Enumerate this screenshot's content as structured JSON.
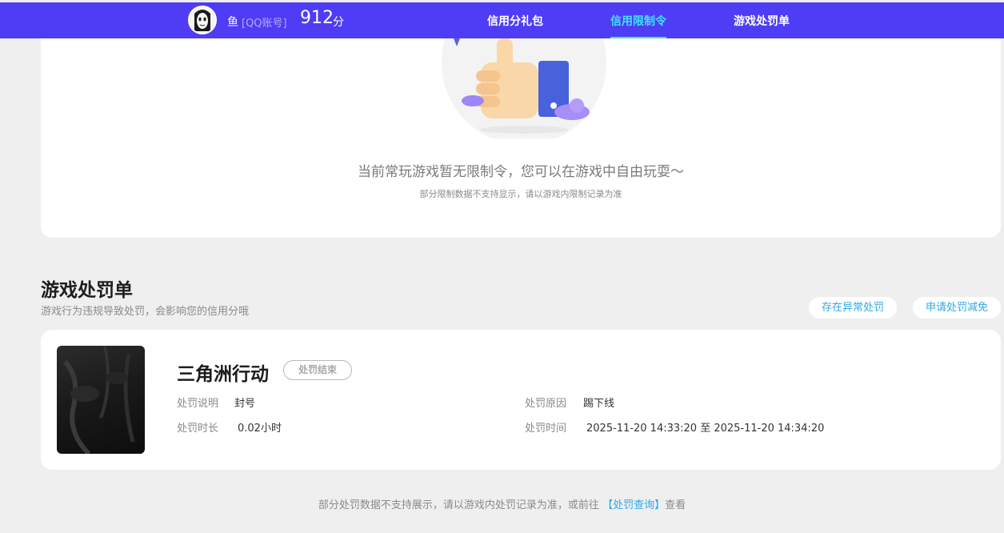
{
  "header": {
    "user_name": "鱼",
    "account_type": "[QQ账号]",
    "score": "912",
    "score_unit": "分",
    "tabs": [
      {
        "label": "信用分礼包",
        "active": false
      },
      {
        "label": "信用限制令",
        "active": true
      },
      {
        "label": "游戏处罚单",
        "active": false
      }
    ]
  },
  "restriction": {
    "empty_title": "当前常玩游戏暂无限制令，您可以在游戏中自由玩耍～",
    "empty_sub": "部分限制数据不支持显示，请以游戏内限制记录为准"
  },
  "penalty": {
    "title": "游戏处罚单",
    "desc": "游戏行为违规导致处罚，会影响您的信用分哦",
    "abnormal_button": "存在异常处罚",
    "reduce_button": "申请处罚减免",
    "records": [
      {
        "game": "三角洲行动",
        "status": "处罚结束",
        "desc_label": "处罚说明",
        "desc_value": "封号",
        "reason_label": "处罚原因",
        "reason_value": "踢下线",
        "duration_label": "处罚时长",
        "duration_value": "0.02小时",
        "time_label": "处罚时间",
        "time_value": "2025-11-20 14:33:20 至 2025-11-20 14:34:20"
      }
    ]
  },
  "footer": {
    "note_before": "部分处罚数据不支持展示，请以游戏内处罚记录为准，或前往",
    "link": "【处罚查询】",
    "note_after": "查看"
  },
  "colors": {
    "header_bg": "#4f3cf5",
    "active_tab": "#3ee3ff",
    "link": "#2fa9e7"
  }
}
